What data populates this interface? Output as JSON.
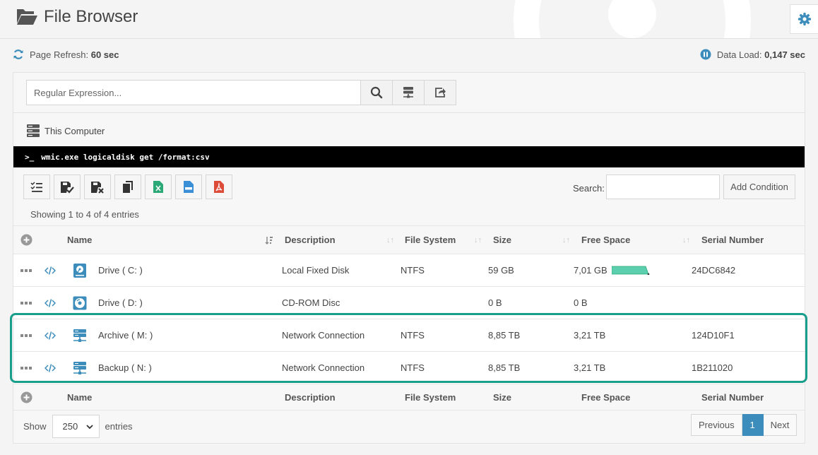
{
  "app": {
    "title": "File Browser"
  },
  "info": {
    "refresh_label": "Page Refresh:",
    "refresh_value": "60 sec",
    "load_label": "Data Load:",
    "load_value": "0,147 sec"
  },
  "search": {
    "placeholder": "Regular Expression..."
  },
  "breadcrumb": {
    "label": "This Computer"
  },
  "command": {
    "prompt": ">_",
    "text": "wmic.exe logicaldisk get /format:csv"
  },
  "filter": {
    "search_label": "Search:",
    "add_condition": "Add Condition"
  },
  "info_text": "Showing 1 to 4 of 4 entries",
  "table": {
    "columns": {
      "name": "Name",
      "description": "Description",
      "file_system": "File System",
      "size": "Size",
      "free_space": "Free Space",
      "serial": "Serial Number"
    },
    "rows": [
      {
        "name": "Drive ( C: )",
        "description": "Local Fixed Disk",
        "file_system": "NTFS",
        "size": "59 GB",
        "free_space": "7,01 GB",
        "serial": "24DC6842",
        "icon": "hard-drive-icon"
      },
      {
        "name": "Drive ( D: )",
        "description": "CD-ROM Disc",
        "file_system": "",
        "size": "0 B",
        "free_space": "0 B",
        "serial": "",
        "icon": "cd-rom-icon"
      },
      {
        "name": "Archive ( M: )",
        "description": "Network Connection",
        "file_system": "NTFS",
        "size": "8,85 TB",
        "free_space": "3,21 TB",
        "serial": "124D10F1",
        "icon": "network-drive-icon"
      },
      {
        "name": "Backup ( N: )",
        "description": "Network Connection",
        "file_system": "NTFS",
        "size": "8,85 TB",
        "free_space": "3,21 TB",
        "serial": "1B211020",
        "icon": "network-drive-icon"
      }
    ]
  },
  "footer": {
    "show_label": "Show",
    "page_length": "250",
    "entries_label": "entries",
    "previous": "Previous",
    "current_page": "1",
    "next": "Next"
  },
  "colors": {
    "accent": "#3c8dbc",
    "highlight": "#199e8c",
    "freebar": "#5ccfae"
  }
}
